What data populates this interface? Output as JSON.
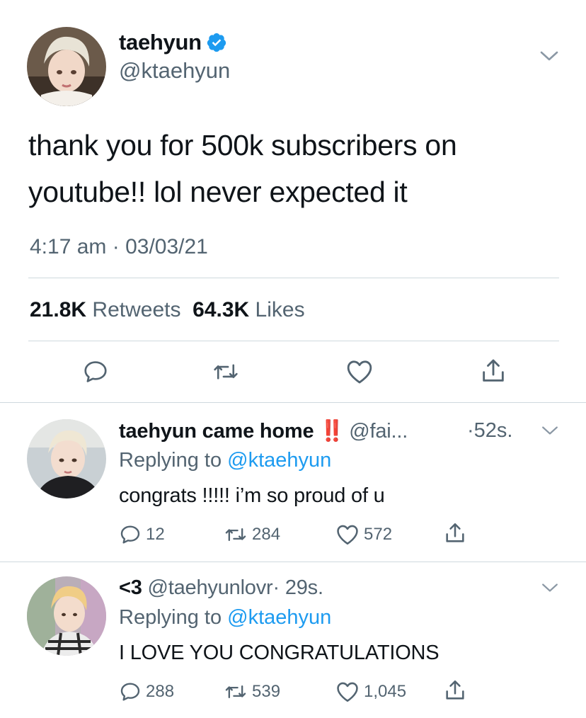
{
  "main_tweet": {
    "display_name": "taehyun",
    "handle": "@ktaehyun",
    "text": "thank you for 500k subscribers on youtube!! lol never expected it",
    "time": "4:17 am",
    "separator": "·",
    "date": "03/03/21",
    "retweets_count": "21.8K",
    "retweets_label": "Retweets",
    "likes_count": "64.3K",
    "likes_label": "Likes",
    "icons": [
      "reply-icon",
      "retweet-icon",
      "like-icon",
      "share-icon"
    ]
  },
  "replies": [
    {
      "display_name": "taehyun came home",
      "emoji": "‼️",
      "handle": "@fai...",
      "age": "·52s.",
      "replying_prefix": "Replying to",
      "replying_to": "@ktaehyun",
      "text": "congrats !!!!! i’m so proud of u",
      "reply_count": "12",
      "retweet_count": "284",
      "like_count": "572"
    },
    {
      "display_name": "<3",
      "handle": "@taehyunlovr",
      "age": "· 29s.",
      "replying_prefix": "Replying to",
      "replying_to": "@ktaehyun",
      "text": "I LOVE YOU CONGRATULATIONS",
      "reply_count": "288",
      "retweet_count": "539",
      "like_count": "1,045"
    }
  ],
  "colors": {
    "primary_text": "#0f1419",
    "secondary_text": "#536471",
    "link_blue": "#1d9bf0",
    "divider": "#cfd9de",
    "verified_blue": "#1d9bf0"
  }
}
